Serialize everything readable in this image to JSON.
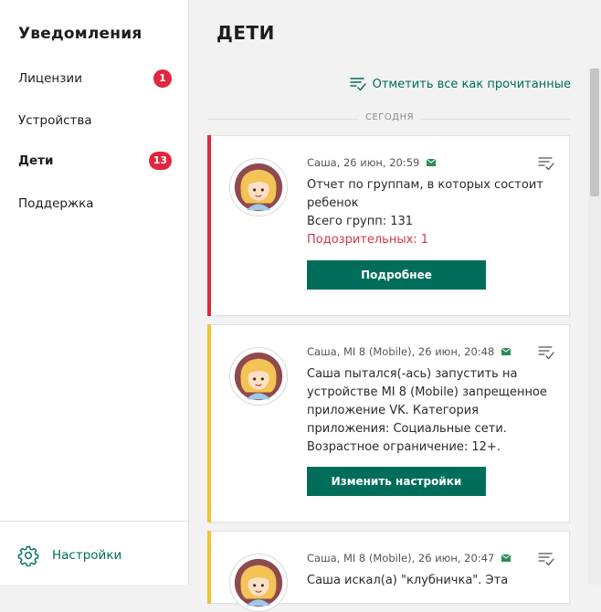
{
  "sidebar": {
    "title": "Уведомления",
    "items": [
      {
        "label": "Лицензии",
        "badge": "1"
      },
      {
        "label": "Устройства",
        "badge": ""
      },
      {
        "label": "Дети",
        "badge": "13"
      },
      {
        "label": "Поддержка",
        "badge": ""
      }
    ],
    "settings_label": "Настройки"
  },
  "main": {
    "title": "ДЕТИ",
    "mark_all_label": "Отметить все как прочитанные",
    "day_label": "СЕГОДНЯ",
    "notifications": [
      {
        "meta": "Саша, 26 июн, 20:59",
        "lines": [
          "Отчет по группам, в которых состоит",
          "ребенок",
          "Всего групп: 131"
        ],
        "warning": "Подозрительных: 1",
        "button": "Подробнее",
        "stripe_color": "#e0283e"
      },
      {
        "meta": "Саша, MI 8 (Mobile), 26 июн, 20:48",
        "lines": [
          "Саша пытался(-ась) запустить на",
          "устройстве MI 8 (Mobile) запрещенное",
          "приложение VK. Категория",
          "приложения: Социальные сети.",
          "Возрастное ограничение: 12+."
        ],
        "button": "Изменить настройки",
        "stripe_color": "#f5c330"
      },
      {
        "meta": "Саша, MI 8 (Mobile), 26 июн, 20:47",
        "lines": [
          "Саша искал(а) \"клубничка\". Эта"
        ],
        "stripe_color": "#f5c330"
      }
    ]
  },
  "colors": {
    "accent": "#006d5b",
    "badge": "#e0283e",
    "warning_text": "#d0374e"
  }
}
